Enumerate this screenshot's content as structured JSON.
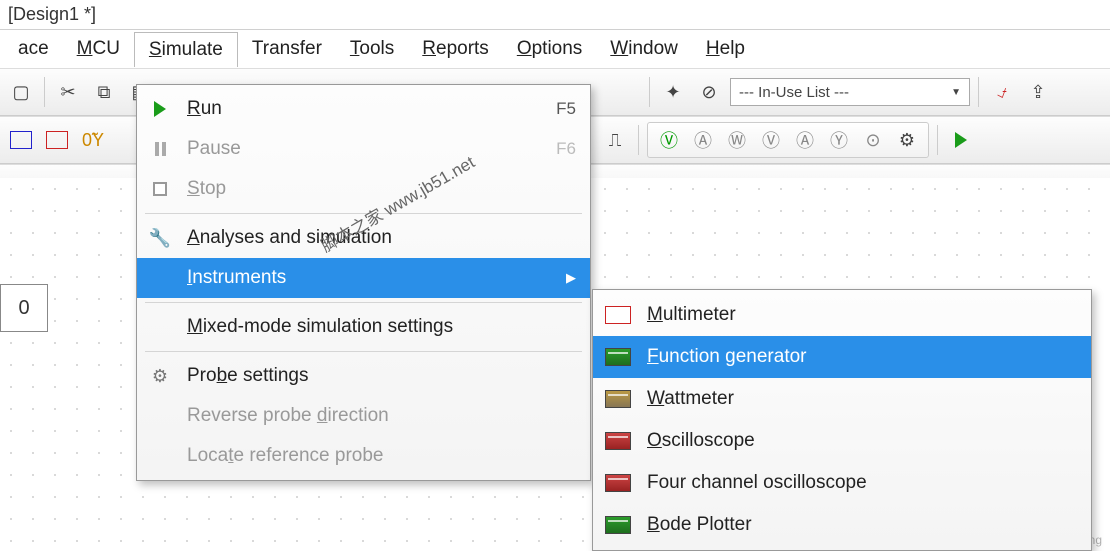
{
  "title": "[Design1 *]",
  "menu_bar": {
    "place": "ace",
    "mcu": "MCU",
    "simulate": "Simulate",
    "transfer": "Transfer",
    "tools": "Tools",
    "reports": "Reports",
    "options": "Options",
    "window": "Window",
    "help": "Help"
  },
  "toolbar": {
    "in_use_list": "--- In-Use List ---"
  },
  "simulate_menu": {
    "run": {
      "label": "Run",
      "shortcut": "F5"
    },
    "pause": {
      "label": "Pause",
      "shortcut": "F6"
    },
    "stop": {
      "label": "Stop"
    },
    "analyses": {
      "label": "Analyses and simulation"
    },
    "instruments": {
      "label": "Instruments"
    },
    "mixed": {
      "label": "Mixed-mode simulation settings"
    },
    "probe_settings": {
      "label": "Probe settings"
    },
    "reverse_probe": {
      "label": "Reverse probe direction"
    },
    "locate_probe": {
      "label": "Locate reference probe"
    }
  },
  "instruments_submenu": {
    "multimeter": "Multimeter",
    "function_generator": "Function generator",
    "wattmeter": "Wattmeter",
    "oscilloscope": "Oscilloscope",
    "four_channel": "Four channel oscilloscope",
    "bode_plotter": "Bode Plotter"
  },
  "canvas_label": "0",
  "watermark_site": "脚本之家 www.jb51.net",
  "watermark_csdn": "CSDN @timerring"
}
